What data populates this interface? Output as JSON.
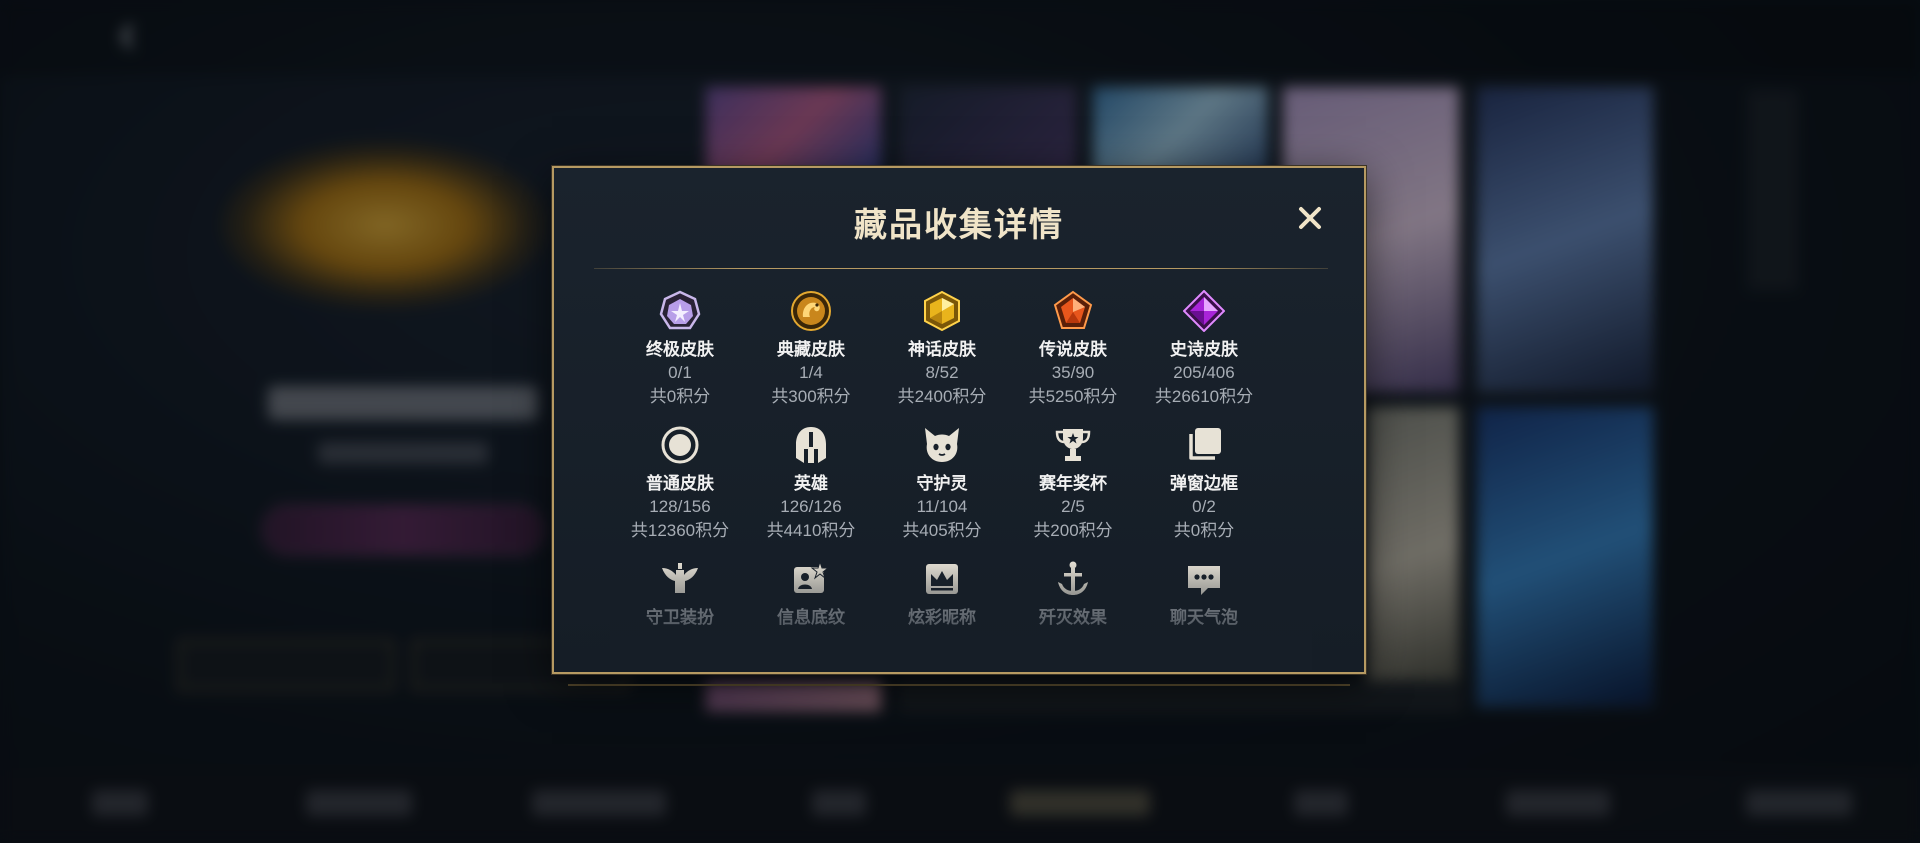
{
  "modal": {
    "title": "藏品收集详情",
    "close_icon": "close-icon"
  },
  "colors": {
    "gold_border": "#b69a62",
    "title_text": "#f0e4c8",
    "label_text": "#f1f1f1",
    "muted_text": "#a7adb5",
    "panel_bg": "#18202a"
  },
  "items": [
    {
      "name": "终极皮肤",
      "count": "0/1",
      "points": "共0积分",
      "icon": "ultimate-skin-icon"
    },
    {
      "name": "典藏皮肤",
      "count": "1/4",
      "points": "共300积分",
      "icon": "treasure-skin-icon"
    },
    {
      "name": "神话皮肤",
      "count": "8/52",
      "points": "共2400积分",
      "icon": "mythic-skin-icon"
    },
    {
      "name": "传说皮肤",
      "count": "35/90",
      "points": "共5250积分",
      "icon": "legend-skin-icon"
    },
    {
      "name": "史诗皮肤",
      "count": "205/406",
      "points": "共26610积分",
      "icon": "epic-skin-icon"
    },
    {
      "name": "普通皮肤",
      "count": "128/156",
      "points": "共12360积分",
      "icon": "normal-skin-icon"
    },
    {
      "name": "英雄",
      "count": "126/126",
      "points": "共4410积分",
      "icon": "hero-helmet-icon"
    },
    {
      "name": "守护灵",
      "count": "11/104",
      "points": "共405积分",
      "icon": "guardian-spirit-icon"
    },
    {
      "name": "赛年奖杯",
      "count": "2/5",
      "points": "共200积分",
      "icon": "trophy-icon"
    },
    {
      "name": "弹窗边框",
      "count": "0/2",
      "points": "共0积分",
      "icon": "popup-frame-icon"
    },
    {
      "name": "守卫装扮",
      "icon": "guard-outfit-icon"
    },
    {
      "name": "信息底纹",
      "icon": "info-background-icon"
    },
    {
      "name": "炫彩昵称",
      "icon": "colorful-nickname-icon"
    },
    {
      "name": "歼灭效果",
      "icon": "annihilate-effect-icon"
    },
    {
      "name": "聊天气泡",
      "icon": "chat-bubble-icon"
    }
  ]
}
